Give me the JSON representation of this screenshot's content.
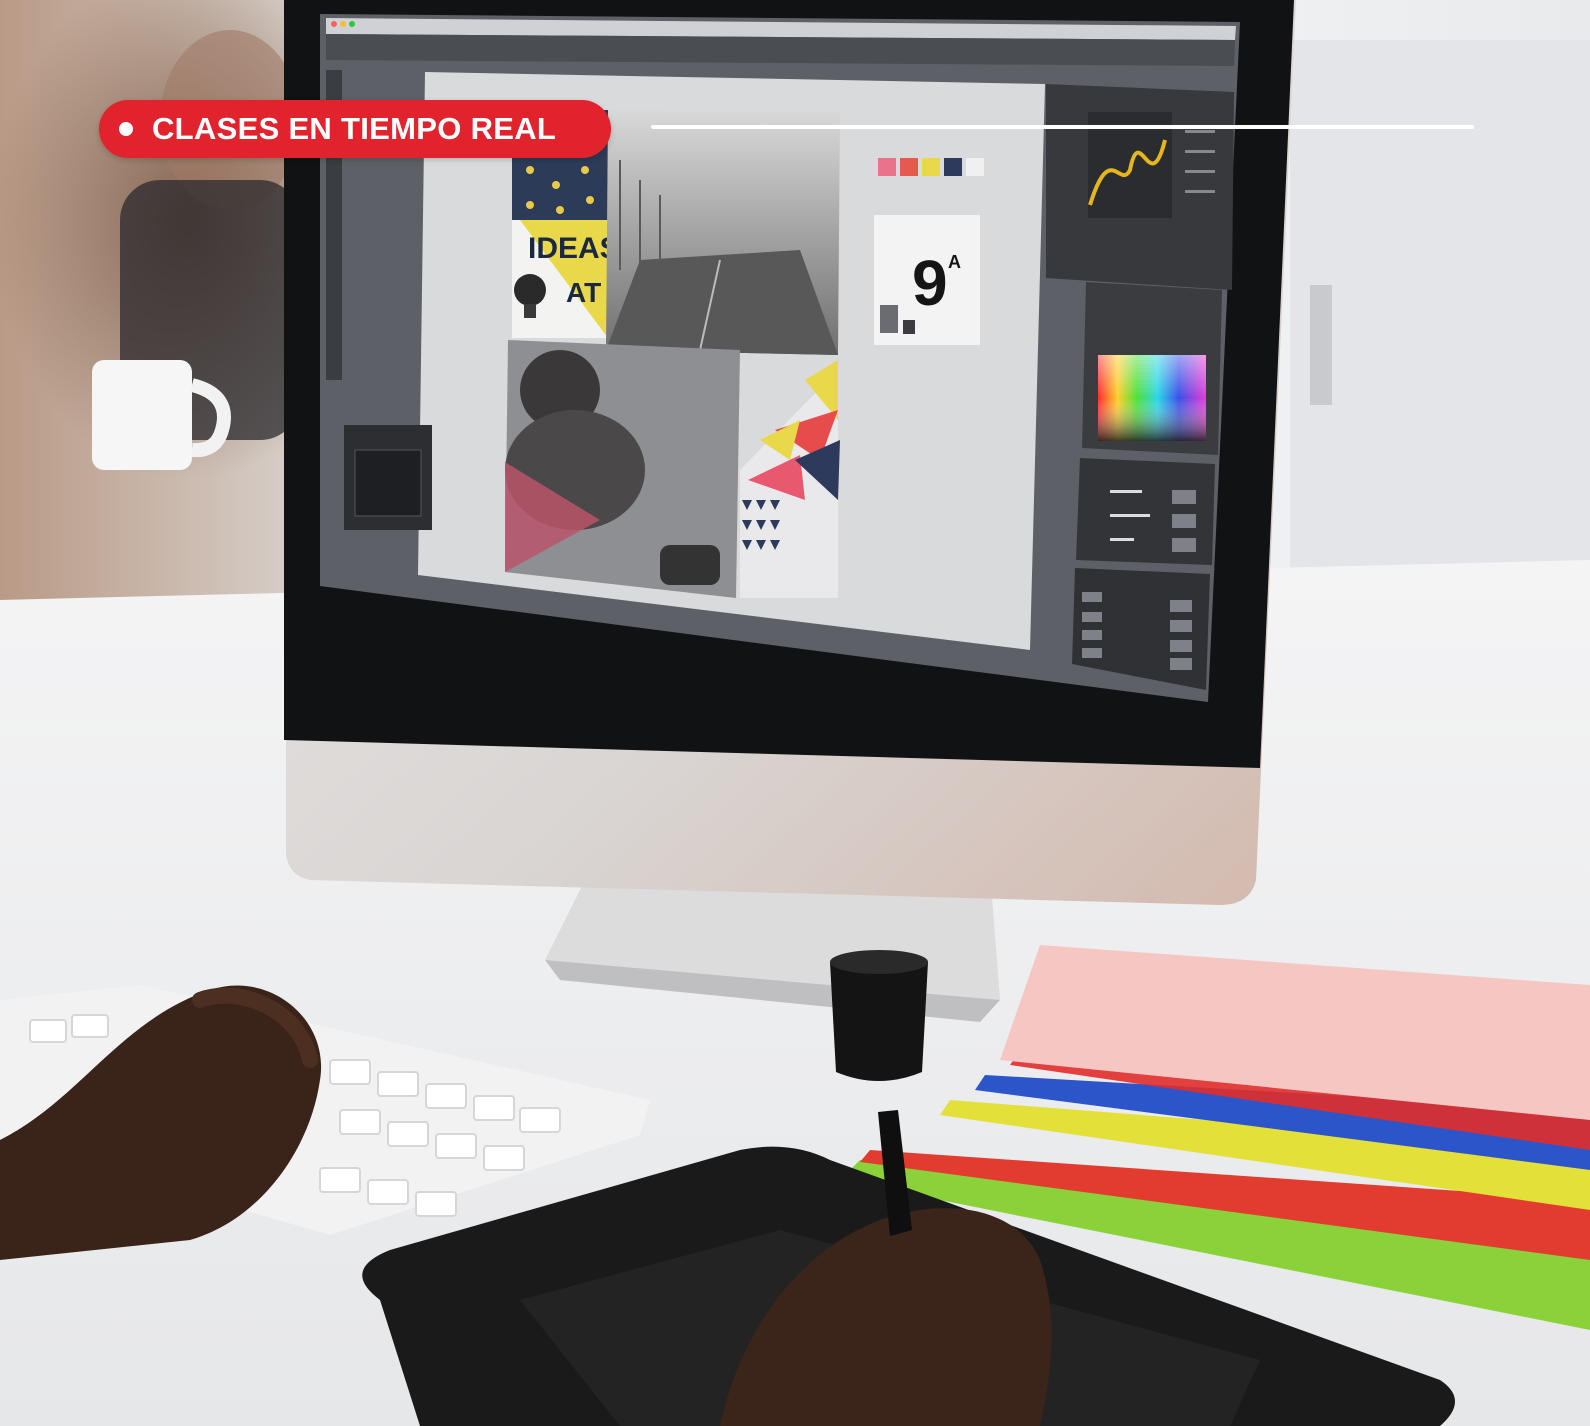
{
  "badge": {
    "label": "CLASES EN TIEMPO REAL",
    "color": "#e0232d"
  },
  "scene": {
    "canvas_poster": {
      "ideas_text": "IDEAS",
      "at_text": "AT",
      "number_text": "9",
      "superscript_text": "A"
    }
  }
}
